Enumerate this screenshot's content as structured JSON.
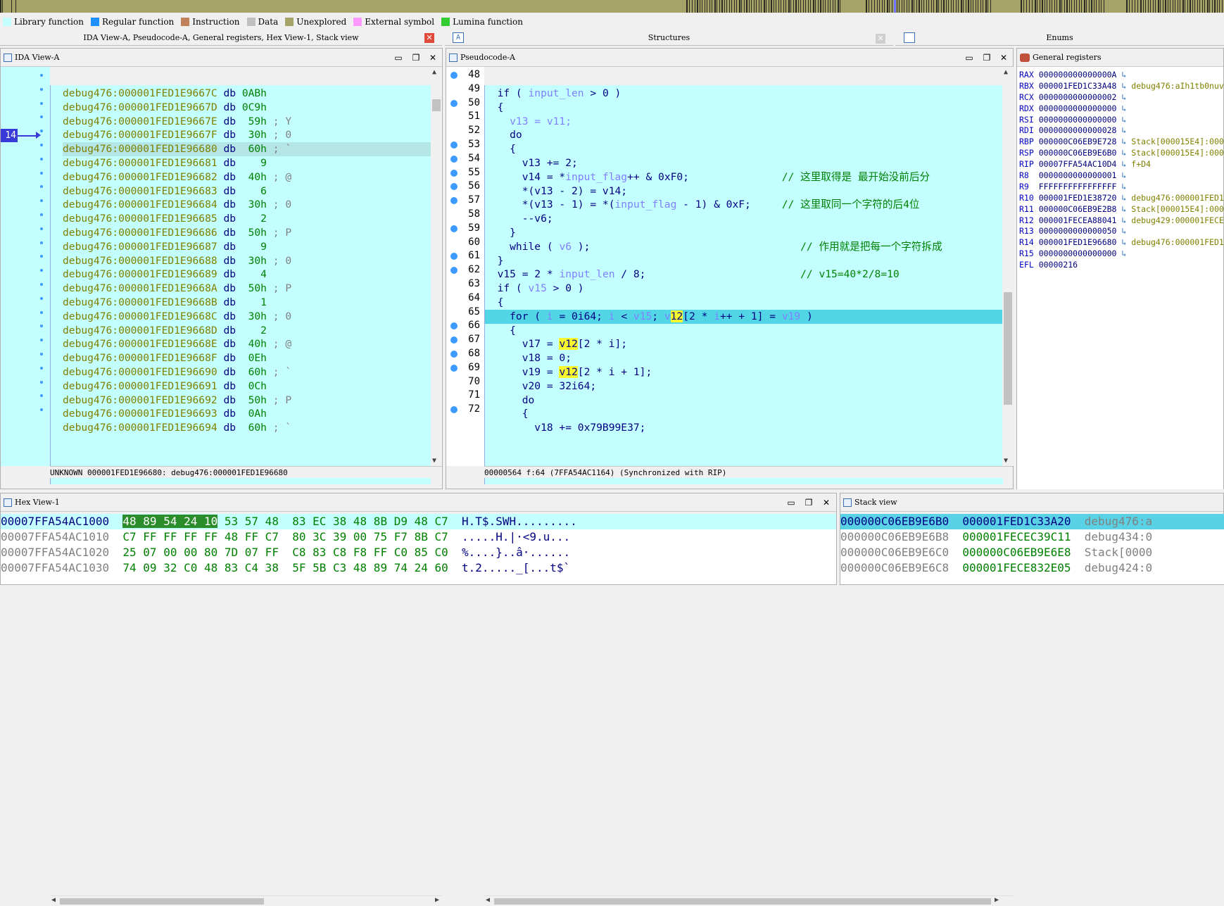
{
  "legend": [
    {
      "label": "Library function",
      "color": "#c4ffff"
    },
    {
      "label": "Regular function",
      "color": "#1e90ff"
    },
    {
      "label": "Instruction",
      "color": "#c0805a"
    },
    {
      "label": "Data",
      "color": "#c0c0c0"
    },
    {
      "label": "Unexplored",
      "color": "#a5a368"
    },
    {
      "label": "External symbol",
      "color": "#ff99ff"
    },
    {
      "label": "Lumina function",
      "color": "#33cc33"
    }
  ],
  "tabs": {
    "left": "IDA View-A, Pseudocode-A, General registers, Hex View-1, Stack view",
    "structures": "Structures",
    "enums": "Enums"
  },
  "ida": {
    "title": "IDA View-A",
    "marker": "14",
    "rows": [
      {
        "addr": "debug476:000001FED1E9667C",
        "op": "db",
        "val": "0ABh",
        "cmt": ""
      },
      {
        "addr": "debug476:000001FED1E9667D",
        "op": "db",
        "val": "0C9h",
        "cmt": ""
      },
      {
        "addr": "debug476:000001FED1E9667E",
        "op": "db",
        "val": " 59h",
        "cmt": " ; Y"
      },
      {
        "addr": "debug476:000001FED1E9667F",
        "op": "db",
        "val": " 30h",
        "cmt": " ; 0"
      },
      {
        "addr": "debug476:000001FED1E96680",
        "op": "db",
        "val": " 60h",
        "cmt": " ; `"
      },
      {
        "addr": "debug476:000001FED1E96681",
        "op": "db",
        "val": "   9",
        "cmt": ""
      },
      {
        "addr": "debug476:000001FED1E96682",
        "op": "db",
        "val": " 40h",
        "cmt": " ; @"
      },
      {
        "addr": "debug476:000001FED1E96683",
        "op": "db",
        "val": "   6",
        "cmt": ""
      },
      {
        "addr": "debug476:000001FED1E96684",
        "op": "db",
        "val": " 30h",
        "cmt": " ; 0"
      },
      {
        "addr": "debug476:000001FED1E96685",
        "op": "db",
        "val": "   2",
        "cmt": ""
      },
      {
        "addr": "debug476:000001FED1E96686",
        "op": "db",
        "val": " 50h",
        "cmt": " ; P"
      },
      {
        "addr": "debug476:000001FED1E96687",
        "op": "db",
        "val": "   9",
        "cmt": ""
      },
      {
        "addr": "debug476:000001FED1E96688",
        "op": "db",
        "val": " 30h",
        "cmt": " ; 0"
      },
      {
        "addr": "debug476:000001FED1E96689",
        "op": "db",
        "val": "   4",
        "cmt": ""
      },
      {
        "addr": "debug476:000001FED1E9668A",
        "op": "db",
        "val": " 50h",
        "cmt": " ; P"
      },
      {
        "addr": "debug476:000001FED1E9668B",
        "op": "db",
        "val": "   1",
        "cmt": ""
      },
      {
        "addr": "debug476:000001FED1E9668C",
        "op": "db",
        "val": " 30h",
        "cmt": " ; 0"
      },
      {
        "addr": "debug476:000001FED1E9668D",
        "op": "db",
        "val": "   2",
        "cmt": ""
      },
      {
        "addr": "debug476:000001FED1E9668E",
        "op": "db",
        "val": " 40h",
        "cmt": " ; @"
      },
      {
        "addr": "debug476:000001FED1E9668F",
        "op": "db",
        "val": " 0Eh",
        "cmt": ""
      },
      {
        "addr": "debug476:000001FED1E96690",
        "op": "db",
        "val": " 60h",
        "cmt": " ; `"
      },
      {
        "addr": "debug476:000001FED1E96691",
        "op": "db",
        "val": " 0Ch",
        "cmt": ""
      },
      {
        "addr": "debug476:000001FED1E96692",
        "op": "db",
        "val": " 50h",
        "cmt": " ; P"
      },
      {
        "addr": "debug476:000001FED1E96693",
        "op": "db",
        "val": " 0Ah",
        "cmt": ""
      },
      {
        "addr": "debug476:000001FED1E96694",
        "op": "db",
        "val": " 60h",
        "cmt": " ; `"
      }
    ],
    "status": "UNKNOWN 000001FED1E96680: debug476:000001FED1E96680"
  },
  "pseudo": {
    "title": "Pseudocode-A",
    "lines": [
      {
        "n": "48",
        "dot": true,
        "segs": [
          [
            "  if ( ",
            "n"
          ],
          [
            "input_len",
            "v"
          ],
          [
            " > 0 )",
            "n"
          ]
        ]
      },
      {
        "n": "49",
        "dot": false,
        "segs": [
          [
            "  {",
            "n"
          ]
        ]
      },
      {
        "n": "50",
        "dot": true,
        "segs": [
          [
            "    v13 = v11;",
            "v"
          ]
        ]
      },
      {
        "n": "51",
        "dot": false,
        "segs": [
          [
            "    do",
            "n"
          ]
        ]
      },
      {
        "n": "52",
        "dot": false,
        "segs": [
          [
            "    {",
            "n"
          ]
        ]
      },
      {
        "n": "53",
        "dot": true,
        "segs": [
          [
            "      v13 += 2;",
            "n"
          ]
        ]
      },
      {
        "n": "54",
        "dot": true,
        "segs": [
          [
            "      v14 = *",
            "n"
          ],
          [
            "input_flag",
            "v"
          ],
          [
            "++ & 0xF0;               ",
            "n"
          ],
          [
            "// 这里取得是 最开始没前后分",
            "g"
          ]
        ]
      },
      {
        "n": "55",
        "dot": true,
        "segs": [
          [
            "      *(v13 - 2) = v14;",
            "n"
          ]
        ]
      },
      {
        "n": "56",
        "dot": true,
        "segs": [
          [
            "      *(v13 - 1) = *(",
            "n"
          ],
          [
            "input_flag",
            "v"
          ],
          [
            " - 1) & 0xF;     ",
            "n"
          ],
          [
            "// 这里取同一个字符的后4位",
            "g"
          ]
        ]
      },
      {
        "n": "57",
        "dot": true,
        "segs": [
          [
            "      --v6;",
            "n"
          ]
        ]
      },
      {
        "n": "58",
        "dot": false,
        "segs": [
          [
            "    }",
            "n"
          ]
        ]
      },
      {
        "n": "59",
        "dot": true,
        "segs": [
          [
            "    while ( ",
            "n"
          ],
          [
            "v6",
            "v"
          ],
          [
            " );                                  ",
            "n"
          ],
          [
            "// 作用就是把每一个字符拆成",
            "g"
          ]
        ]
      },
      {
        "n": "60",
        "dot": false,
        "segs": [
          [
            "  }",
            "n"
          ]
        ]
      },
      {
        "n": "61",
        "dot": true,
        "segs": [
          [
            "  v15 = 2 * ",
            "n"
          ],
          [
            "input_len",
            "v"
          ],
          [
            " / 8;                         ",
            "n"
          ],
          [
            "// v15=40*2/8=10",
            "g"
          ]
        ]
      },
      {
        "n": "62",
        "dot": true,
        "segs": [
          [
            "  if ( ",
            "n"
          ],
          [
            "v15",
            "v"
          ],
          [
            " > 0 )",
            "n"
          ]
        ]
      },
      {
        "n": "63",
        "dot": false,
        "segs": [
          [
            "  {",
            "n"
          ]
        ]
      },
      {
        "n": "64",
        "dot": false,
        "hl": true,
        "segs": [
          [
            "    for ( ",
            "n"
          ],
          [
            "i",
            "v"
          ],
          [
            " = 0i64; ",
            "n"
          ],
          [
            "i",
            "v"
          ],
          [
            " < ",
            "n"
          ],
          [
            "v15",
            "v"
          ],
          [
            "; ",
            "n"
          ],
          [
            "v",
            "v"
          ],
          [
            "12",
            "y"
          ],
          [
            "[2 * ",
            "n"
          ],
          [
            "i",
            "v"
          ],
          [
            "++ + 1] = ",
            "n"
          ],
          [
            "v19",
            "v"
          ],
          [
            " )",
            "n"
          ]
        ]
      },
      {
        "n": "65",
        "dot": false,
        "segs": [
          [
            "    {",
            "n"
          ]
        ]
      },
      {
        "n": "66",
        "dot": true,
        "segs": [
          [
            "      v17 = ",
            "n"
          ],
          [
            "v12",
            "y"
          ],
          [
            "[2 * i];",
            "n"
          ]
        ]
      },
      {
        "n": "67",
        "dot": true,
        "segs": [
          [
            "      v18 = 0;",
            "n"
          ]
        ]
      },
      {
        "n": "68",
        "dot": true,
        "segs": [
          [
            "      v19 = ",
            "n"
          ],
          [
            "v12",
            "y"
          ],
          [
            "[2 * i + 1];",
            "n"
          ]
        ]
      },
      {
        "n": "69",
        "dot": true,
        "segs": [
          [
            "      v20 = 32i64;",
            "n"
          ]
        ]
      },
      {
        "n": "70",
        "dot": false,
        "segs": [
          [
            "      do",
            "n"
          ]
        ]
      },
      {
        "n": "71",
        "dot": false,
        "segs": [
          [
            "      {",
            "n"
          ]
        ]
      },
      {
        "n": "72",
        "dot": true,
        "segs": [
          [
            "        v18 += 0x79B99E37;",
            "n"
          ]
        ]
      }
    ],
    "status": "00000564 f:64 (7FFA54AC1164) (Synchronized with RIP)"
  },
  "registers": {
    "title": "General registers",
    "rows": [
      {
        "name": "RAX",
        "val": "000000000000000A",
        "ref": ""
      },
      {
        "name": "RBX",
        "val": "000001FED1C33A48",
        "ref": "debug476:aIh1tb0nuv"
      },
      {
        "name": "RCX",
        "val": "0000000000000002",
        "ref": ""
      },
      {
        "name": "RDX",
        "val": "0000000000000000",
        "ref": ""
      },
      {
        "name": "RSI",
        "val": "0000000000000000",
        "ref": ""
      },
      {
        "name": "RDI",
        "val": "0000000000000028",
        "ref": ""
      },
      {
        "name": "RBP",
        "val": "000000C06EB9E728",
        "ref": "Stack[000015E4]:000"
      },
      {
        "name": "RSP",
        "val": "000000C06EB9E6B0",
        "ref": "Stack[000015E4]:000"
      },
      {
        "name": "RIP",
        "val": "00007FFA54AC10D4",
        "ref": "f+D4"
      },
      {
        "name": "R8 ",
        "val": "0000000000000001",
        "ref": ""
      },
      {
        "name": "R9 ",
        "val": "FFFFFFFFFFFFFFFF",
        "ref": ""
      },
      {
        "name": "R10",
        "val": "000001FED1E38720",
        "ref": "debug476:000001FED1"
      },
      {
        "name": "R11",
        "val": "000000C06EB9E2B8",
        "ref": "Stack[000015E4]:000"
      },
      {
        "name": "R12",
        "val": "000001FECEA88041",
        "ref": "debug429:000001FECE"
      },
      {
        "name": "R13",
        "val": "0000000000000050",
        "ref": ""
      },
      {
        "name": "R14",
        "val": "000001FED1E96680",
        "ref": "debug476:000001FED1"
      },
      {
        "name": "R15",
        "val": "0000000000000000",
        "ref": ""
      },
      {
        "name": "EFL",
        "val": "00000216",
        "ref": ""
      }
    ]
  },
  "hex": {
    "title": "Hex View-1",
    "rows": [
      {
        "addr": "00007FFA54AC1000",
        "sel": "48 89 54 24 10",
        "rest": " 53 57 48  83 EC 38 48 8B D9 48 C7",
        "ascii": "H.T$.SWH........."
      },
      {
        "addr": "00007FFA54AC1010",
        "sel": "",
        "rest": "C7 FF FF FF FF 48 FF C7  80 3C 39 00 75 F7 8B C7",
        "ascii": ".....H.|·<9.u..."
      },
      {
        "addr": "00007FFA54AC1020",
        "sel": "",
        "rest": "25 07 00 00 80 7D 07 FF  C8 83 C8 F8 FF C0 85 C0",
        "ascii": "%....}..â·......"
      },
      {
        "addr": "00007FFA54AC1030",
        "sel": "",
        "rest": "74 09 32 C0 48 83 C4 38  5F 5B C3 48 89 74 24 60",
        "ascii": "t.2....._[...t$`"
      }
    ]
  },
  "stack": {
    "title": "Stack view",
    "rows": [
      {
        "addr": "000000C06EB9E6B0",
        "val": "000001FED1C33A20",
        "ref": "debug476:a"
      },
      {
        "addr": "000000C06EB9E6B8",
        "val": "000001FECEC39C11",
        "ref": "debug434:0"
      },
      {
        "addr": "000000C06EB9E6C0",
        "val": "000000C06EB9E6E8",
        "ref": "Stack[0000"
      },
      {
        "addr": "000000C06EB9E6C8",
        "val": "000001FECE832E05",
        "ref": "debug424:0"
      }
    ]
  }
}
